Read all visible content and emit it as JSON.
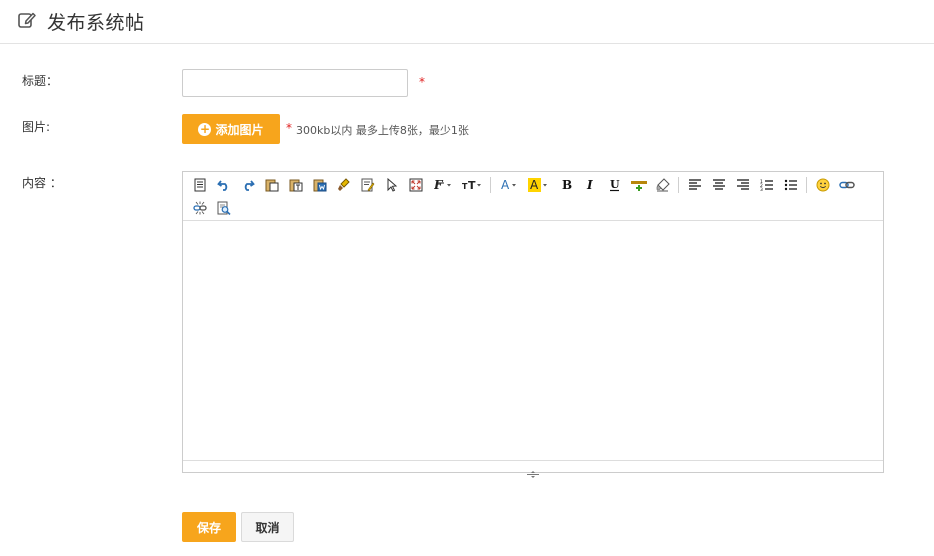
{
  "header": {
    "title": "发布系统帖",
    "icon": "edit-icon"
  },
  "form": {
    "title_label": "标题：",
    "title_value": "",
    "image_label": "图片:",
    "add_image_label": "添加图片",
    "image_hint": "300kb以内 最多上传8张，最少1张",
    "content_label": "内容 ：",
    "required_mark": "*"
  },
  "editor": {
    "toolbar": [
      "source-icon",
      "undo-icon",
      "redo-icon",
      "paste-icon",
      "paste-text-icon",
      "paste-word-icon",
      "format-clear-brush-icon",
      "spellcheck-icon",
      "select-all-icon",
      "fullscreen-icon",
      "font-family-icon",
      "font-size-icon",
      "font-color-icon",
      "highlight-color-icon",
      "bold-icon",
      "italic-icon",
      "underline-icon",
      "insert-hr-icon",
      "remove-format-icon",
      "align-left-icon",
      "align-center-icon",
      "align-right-icon",
      "ordered-list-icon",
      "unordered-list-icon",
      "emoticon-icon",
      "link-icon",
      "unlink-icon",
      "preview-icon"
    ],
    "content": ""
  },
  "actions": {
    "save_label": "保存",
    "cancel_label": "取消"
  },
  "colors": {
    "accent": "#f7a51c",
    "required": "#e02020",
    "border": "#cccccc"
  }
}
